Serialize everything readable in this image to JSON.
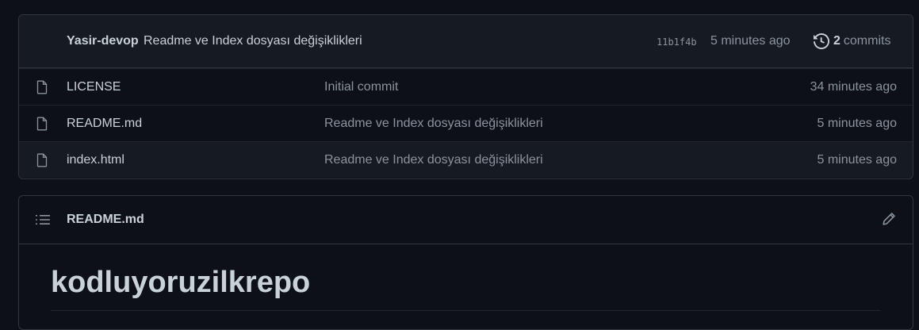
{
  "latest_commit": {
    "author": "Yasir-devop",
    "message": "Readme ve Index dosyası değişiklikleri",
    "sha": "11b1f4b",
    "time": "5 minutes ago",
    "commit_count": "2",
    "commit_label": "commits",
    "icon": "history-icon"
  },
  "files": [
    {
      "name": "LICENSE",
      "message": "Initial commit",
      "time": "34 minutes ago",
      "icon": "file-icon"
    },
    {
      "name": "README.md",
      "message": "Readme ve Index dosyası değişiklikleri",
      "time": "5 minutes ago",
      "icon": "file-icon"
    },
    {
      "name": "index.html",
      "message": "Readme ve Index dosyası değişiklikleri",
      "time": "5 minutes ago",
      "icon": "file-icon"
    }
  ],
  "readme": {
    "title": "README.md",
    "heading": "kodluyoruzilkrepo",
    "toc_icon": "list-unordered-icon",
    "edit_icon": "pencil-icon"
  },
  "colors": {
    "background": "#0d1117",
    "header_bg": "#161b22",
    "border": "#30363d",
    "text": "#c9d1d9",
    "muted": "#8b949e"
  }
}
